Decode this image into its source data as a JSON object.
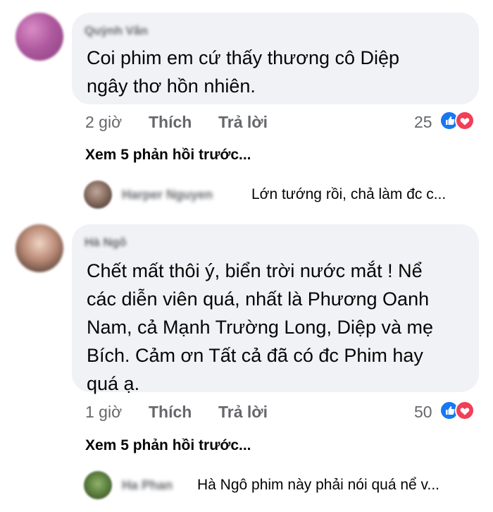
{
  "comments": [
    {
      "author": "Quỳnh Vân",
      "text_lines": [
        "Coi phim em cứ thấy thương cô Diệp",
        "ngây thơ hồn nhiên."
      ],
      "time": "2 giờ",
      "like_label": "Thích",
      "reply_label": "Trả lời",
      "reaction_count": "25",
      "view_more": "Xem 5 phản hồi trước...",
      "reply": {
        "author": "Harper Nguyen",
        "text": "Lớn tướng rồi, chả làm đc c..."
      }
    },
    {
      "author": "Hà Ngô",
      "text_lines": [
        "Chết mất thôi ý, biển trời nước mắt ! Nể",
        "các diễn viên quá, nhất là Phương Oanh",
        "Nam, cả Mạnh Trường Long, Diệp và mẹ",
        "Bích. Cảm ơn Tất cả đã có đc Phim hay",
        "quá ạ."
      ],
      "time": "1 giờ",
      "like_label": "Thích",
      "reply_label": "Trả lời",
      "reaction_count": "50",
      "view_more": "Xem 5 phản hồi trước...",
      "reply": {
        "author": "Ha Phan",
        "text": "Hà Ngô phim này phải nói quá nể v..."
      }
    }
  ],
  "icons": {
    "like": "like-icon",
    "love": "love-icon"
  },
  "colors": {
    "bubble": "#f0f2f5",
    "meta": "#65676b",
    "like": "#1877f2",
    "love": "#f33e58"
  }
}
